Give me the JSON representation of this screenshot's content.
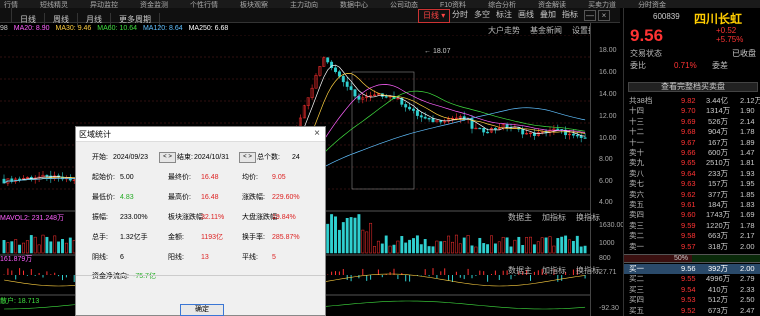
{
  "menu": [
    "行情",
    "短线精灵",
    "异动监控",
    "资金监测",
    "个性行情",
    "板块观察",
    "主力动向",
    "数据中心",
    "公司动态",
    "F10资料",
    "综合分析",
    "资金解读",
    "买卖力道",
    "分时资金"
  ],
  "tabs": {
    "daily": "日线",
    "period_list": [
      "周线",
      "月线"
    ],
    "more": "更多周期",
    "period": "日线",
    "right_tabs": [
      "分时",
      "多空",
      "标注",
      "画线",
      "叠加",
      "指标",
      "显示",
      "设置"
    ]
  },
  "ma_legend": {
    "prefix": "98",
    "ma20": "MA20: 8.90",
    "ma30": "MA30: 9.46",
    "ma60": "MA60: 10.64",
    "ma120": "MA120: 8.64",
    "ma250": "MA250: 6.68"
  },
  "chart_tabs": {
    "t1": "大户走势",
    "t2": "基金新闻",
    "t3": "设置指标"
  },
  "chart_data": {
    "type": "candlestick",
    "peak_label": "18.07",
    "price_axis": [
      "18.00",
      "16.00",
      "14.00",
      "12.00",
      "10.00",
      "8.00",
      "6.00",
      "4.00"
    ],
    "vol_axis": [
      "1630.00",
      "1000",
      "800"
    ],
    "vol_axis2": [
      "27.71",
      "-92.30"
    ],
    "volume_series_label": "MAVOL2: 231.248万",
    "indicator_label": "161.879万",
    "indicator2_label": "0.00",
    "last_label": "散户: 18.713"
  },
  "sub_buttons": {
    "a": "数据主",
    "b": "加指标",
    "c": "换指标"
  },
  "quote": {
    "code": "600839",
    "name": "四川长虹",
    "price": "9.56",
    "change": "+0.52",
    "pct": "+5.75%",
    "status_label": "交易状态",
    "status_value": "已收盘",
    "weibi_label": "委比",
    "weibi_value": "0.71%",
    "weicha_label": "委差",
    "weicha_value": "",
    "full_book": "查看完整档买卖盘",
    "buy_ratio": "50%"
  },
  "asks": [
    {
      "label": "共38档",
      "price": "9.82",
      "vol": "3.44亿",
      "extra": "2.12万"
    },
    {
      "label": "十四",
      "price": "9.70",
      "vol": "1314万",
      "extra": "1.90"
    },
    {
      "label": "十三",
      "price": "9.69",
      "vol": "526万",
      "extra": "2.14"
    },
    {
      "label": "十二",
      "price": "9.68",
      "vol": "904万",
      "extra": "1.78"
    },
    {
      "label": "十一",
      "price": "9.67",
      "vol": "167万",
      "extra": "1.89"
    },
    {
      "label": "卖十",
      "price": "9.66",
      "vol": "600万",
      "extra": "1.47"
    },
    {
      "label": "卖九",
      "price": "9.65",
      "vol": "2510万",
      "extra": "1.81"
    },
    {
      "label": "卖八",
      "price": "9.64",
      "vol": "233万",
      "extra": "1.93"
    },
    {
      "label": "卖七",
      "price": "9.63",
      "vol": "157万",
      "extra": "1.95"
    },
    {
      "label": "卖六",
      "price": "9.62",
      "vol": "377万",
      "extra": "1.85"
    },
    {
      "label": "卖五",
      "price": "9.61",
      "vol": "184万",
      "extra": "1.83"
    },
    {
      "label": "卖四",
      "price": "9.60",
      "vol": "1743万",
      "extra": "1.69"
    },
    {
      "label": "卖三",
      "price": "9.59",
      "vol": "1220万",
      "extra": "1.78"
    },
    {
      "label": "卖二",
      "price": "9.58",
      "vol": "663万",
      "extra": "2.17"
    },
    {
      "label": "卖一",
      "price": "9.57",
      "vol": "318万",
      "extra": "2.00"
    }
  ],
  "bids": [
    {
      "label": "买一",
      "price": "9.56",
      "vol": "392万",
      "extra": "2.00"
    },
    {
      "label": "买二",
      "price": "9.55",
      "vol": "4996万",
      "extra": "2.79"
    },
    {
      "label": "买三",
      "price": "9.54",
      "vol": "410万",
      "extra": "2.33"
    },
    {
      "label": "买四",
      "price": "9.53",
      "vol": "512万",
      "extra": "2.50"
    },
    {
      "label": "买五",
      "price": "9.52",
      "vol": "673万",
      "extra": "2.47"
    },
    {
      "label": "买六",
      "price": "9.51",
      "vol": "725万",
      "extra": "2.41"
    }
  ],
  "dialog": {
    "title": "区域统计",
    "start_label": "开始:",
    "start_date": "2024/09/23",
    "end_label": "结束:",
    "end_date": "2024/10/31",
    "count_label": "总个数:",
    "count": "24",
    "r1": {
      "a_label": "起始价:",
      "a": "5.00",
      "b_label": "最终价:",
      "b": "16.48",
      "c_label": "均价:",
      "c": "9.05"
    },
    "r2": {
      "a_label": "最低价:",
      "a": "4.83",
      "b_label": "最高价:",
      "b": "16.48",
      "c_label": "涨跌幅:",
      "c": "229.60%"
    },
    "r3": {
      "a_label": "振幅:",
      "a": "233.00%",
      "b_label": "板块涨跌幅:",
      "b": "32.11%",
      "c_label": "大盘涨跌幅:",
      "c": "19.84%"
    },
    "r4": {
      "a_label": "总手:",
      "a": "1.32亿手",
      "b_label": "金额:",
      "b": "1193亿",
      "c_label": "换手率:",
      "c": "285.87%"
    },
    "r5": {
      "a_label": "阴线:",
      "a": "6",
      "b_label": "阳线:",
      "b": "13",
      "c_label": "平线:",
      "c": "5"
    },
    "flow_label": "资金净流向:",
    "flow": "-75.7亿",
    "ok": "确定"
  }
}
